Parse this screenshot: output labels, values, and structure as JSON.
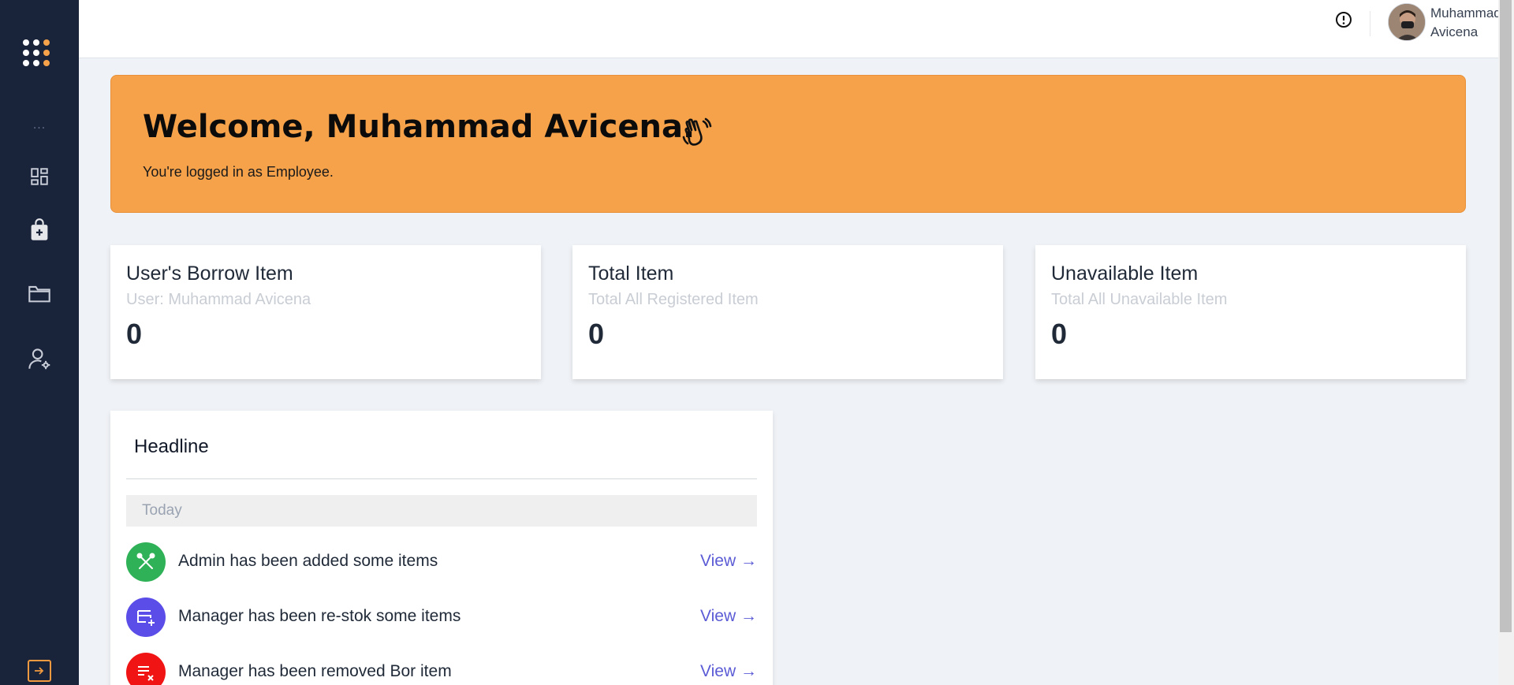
{
  "sidebar": {
    "more_label": "···",
    "items": [
      {
        "icon": "dashboard-icon"
      },
      {
        "icon": "shopping-bag-plus-icon"
      },
      {
        "icon": "folder-icon"
      },
      {
        "icon": "user-settings-icon"
      }
    ],
    "logout_icon": "logout-icon"
  },
  "topbar": {
    "user_name": "Muhammad Avicena"
  },
  "banner": {
    "title": "Welcome, Muhammad Avicena.",
    "subtitle": "You're logged in as Employee."
  },
  "cards": [
    {
      "title": "User's Borrow Item",
      "subtitle": "User: Muhammad Avicena",
      "value": "0"
    },
    {
      "title": "Total Item",
      "subtitle": "Total All Registered Item",
      "value": "0"
    },
    {
      "title": "Unavailable Item",
      "subtitle": "Total All Unavailable Item",
      "value": "0"
    }
  ],
  "headline": {
    "title": "Headline",
    "group_label": "Today",
    "items": [
      {
        "text": "Admin has been added some items",
        "action": "View →",
        "color": "#2fb157"
      },
      {
        "text": "Manager has been re-stok some items",
        "action": "View →",
        "color": "#5a4de8"
      },
      {
        "text": "Manager has been removed Bor item",
        "action": "View →",
        "color": "#f01414"
      }
    ]
  },
  "colors": {
    "sidebar_bg": "#19233a",
    "accent_orange": "#f6a24a",
    "link_purple": "#5b5bd6",
    "page_bg": "#eff2f6"
  }
}
